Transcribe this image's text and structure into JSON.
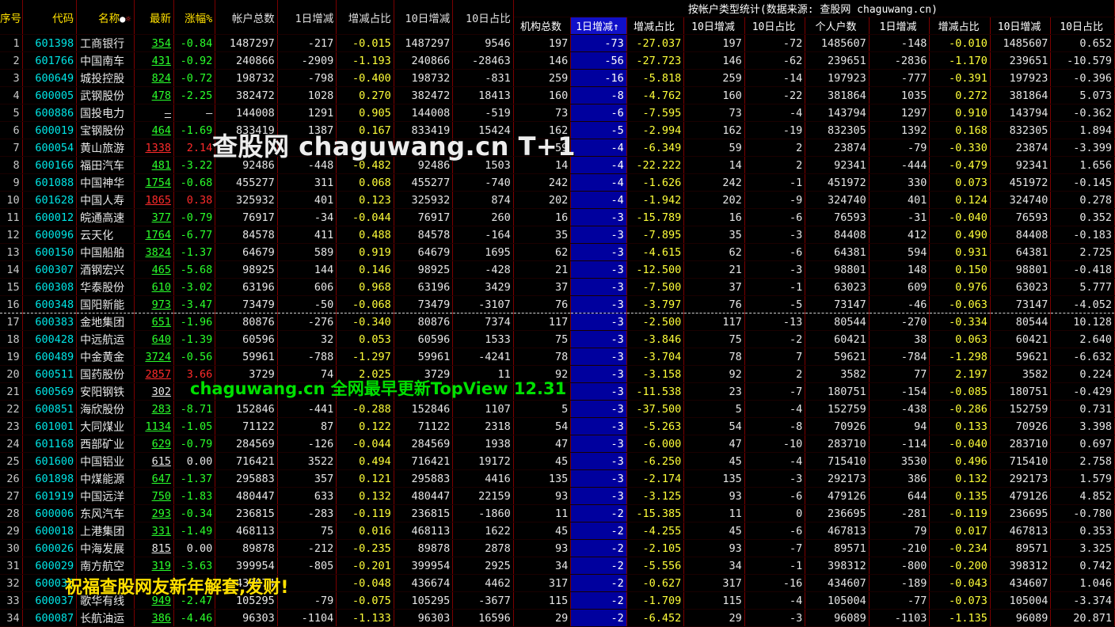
{
  "header": {
    "seq": "序号",
    "code": "代码",
    "name": "名称",
    "name_dot": "●",
    "name_sun": "☼",
    "price": "最新",
    "pct": "涨幅%",
    "total": "帐户总数",
    "d1": "1日增减",
    "ratio": "增减占比",
    "d10": "10日增减",
    "d10r": "10日占比",
    "group_title": "按帐户类型统计(数据来源: 查股网 chaguwang.cn)",
    "inst_total": "机构总数",
    "inst_d1": "1日增减↑",
    "inst_ratio": "增减占比",
    "inst_d10": "10日增减",
    "inst_d10r": "10日占比",
    "ind_total": "个人户数",
    "ind_d1": "1日增减",
    "ind_ratio": "增减占比",
    "ind_d10": "10日增减",
    "ind_d10r": "10日占比"
  },
  "watermarks": {
    "main": "查股网 chaguwang.cn T+1",
    "mid": "chaguwang.cn 全网最早更新TopView 12.31",
    "bottom": "祝福查股网友新年解套,发财!"
  },
  "colors": {
    "up": "#ff2b2b",
    "down": "#2bff2b",
    "sort_column_bg": "#00009e",
    "highlight": "#ffff3a"
  },
  "rows": [
    {
      "seq": "1",
      "code": "601398",
      "name": "工商银行",
      "price": "354",
      "pct": "-0.84",
      "total": "1487297",
      "d1": "-217",
      "ratio": "-0.015",
      "d10": "1487297",
      "d10r": "9546",
      "it": "197",
      "id1": "-73",
      "ir": "-27.037",
      "id10": "197",
      "id10r": "-72",
      "pt": "1485607",
      "pd1": "-148",
      "pr": "-0.010",
      "pd10": "1485607",
      "pd10r": "0.652"
    },
    {
      "seq": "2",
      "code": "601766",
      "name": "中国南车",
      "price": "431",
      "pct": "-0.92",
      "total": "240866",
      "d1": "-2909",
      "ratio": "-1.193",
      "d10": "240866",
      "d10r": "-28463",
      "it": "146",
      "id1": "-56",
      "ir": "-27.723",
      "id10": "146",
      "id10r": "-62",
      "pt": "239651",
      "pd1": "-2836",
      "pr": "-1.170",
      "pd10": "239651",
      "pd10r": "-10.579"
    },
    {
      "seq": "3",
      "code": "600649",
      "name": "城投控股",
      "price": "824",
      "pct": "-0.72",
      "total": "198732",
      "d1": "-798",
      "ratio": "-0.400",
      "d10": "198732",
      "d10r": "-831",
      "it": "259",
      "id1": "-16",
      "ir": "-5.818",
      "id10": "259",
      "id10r": "-14",
      "pt": "197923",
      "pd1": "-777",
      "pr": "-0.391",
      "pd10": "197923",
      "pd10r": "-0.396"
    },
    {
      "seq": "4",
      "code": "600005",
      "name": "武钢股份",
      "price": "478",
      "pct": "-2.25",
      "total": "382472",
      "d1": "1028",
      "ratio": "0.270",
      "d10": "382472",
      "d10r": "18413",
      "it": "160",
      "id1": "-8",
      "ir": "-4.762",
      "id10": "160",
      "id10r": "-22",
      "pt": "381864",
      "pd1": "1035",
      "pr": "0.272",
      "pd10": "381864",
      "pd10r": "5.073"
    },
    {
      "seq": "5",
      "code": "600886",
      "name": "国投电力",
      "price": "—",
      "pct": "—",
      "total": "144008",
      "d1": "1291",
      "ratio": "0.905",
      "d10": "144008",
      "d10r": "-519",
      "it": "73",
      "id1": "-6",
      "ir": "-7.595",
      "id10": "73",
      "id10r": "-4",
      "pt": "143794",
      "pd1": "1297",
      "pr": "0.910",
      "pd10": "143794",
      "pd10r": "-0.362"
    },
    {
      "seq": "6",
      "code": "600019",
      "name": "宝钢股份",
      "price": "464",
      "pct": "-1.69",
      "total": "833419",
      "d1": "1387",
      "ratio": "0.167",
      "d10": "833419",
      "d10r": "15424",
      "it": "162",
      "id1": "-5",
      "ir": "-2.994",
      "id10": "162",
      "id10r": "-19",
      "pt": "832305",
      "pd1": "1392",
      "pr": "0.168",
      "pd10": "832305",
      "pd10r": "1.894"
    },
    {
      "seq": "7",
      "code": "600054",
      "name": "黄山旅游",
      "price": "1338",
      "pct": "2.14",
      "total": "",
      "d1": "",
      "ratio": "",
      "d10": "",
      "d10r": "",
      "it": "59",
      "id1": "-4",
      "ir": "-6.349",
      "id10": "59",
      "id10r": "2",
      "pt": "23874",
      "pd1": "-79",
      "pr": "-0.330",
      "pd10": "23874",
      "pd10r": "-3.399"
    },
    {
      "seq": "8",
      "code": "600166",
      "name": "福田汽车",
      "price": "481",
      "pct": "-3.22",
      "total": "92486",
      "d1": "-448",
      "ratio": "-0.482",
      "d10": "92486",
      "d10r": "1503",
      "it": "14",
      "id1": "-4",
      "ir": "-22.222",
      "id10": "14",
      "id10r": "2",
      "pt": "92341",
      "pd1": "-444",
      "pr": "-0.479",
      "pd10": "92341",
      "pd10r": "1.656"
    },
    {
      "seq": "9",
      "code": "601088",
      "name": "中国神华",
      "price": "1754",
      "pct": "-0.68",
      "total": "455277",
      "d1": "311",
      "ratio": "0.068",
      "d10": "455277",
      "d10r": "-740",
      "it": "242",
      "id1": "-4",
      "ir": "-1.626",
      "id10": "242",
      "id10r": "-1",
      "pt": "451972",
      "pd1": "330",
      "pr": "0.073",
      "pd10": "451972",
      "pd10r": "-0.145"
    },
    {
      "seq": "10",
      "code": "601628",
      "name": "中国人寿",
      "price": "1865",
      "pct": "0.38",
      "total": "325932",
      "d1": "401",
      "ratio": "0.123",
      "d10": "325932",
      "d10r": "874",
      "it": "202",
      "id1": "-4",
      "ir": "-1.942",
      "id10": "202",
      "id10r": "-9",
      "pt": "324740",
      "pd1": "401",
      "pr": "0.124",
      "pd10": "324740",
      "pd10r": "0.278"
    },
    {
      "seq": "11",
      "code": "600012",
      "name": "皖通高速",
      "price": "377",
      "pct": "-0.79",
      "total": "76917",
      "d1": "-34",
      "ratio": "-0.044",
      "d10": "76917",
      "d10r": "260",
      "it": "16",
      "id1": "-3",
      "ir": "-15.789",
      "id10": "16",
      "id10r": "-6",
      "pt": "76593",
      "pd1": "-31",
      "pr": "-0.040",
      "pd10": "76593",
      "pd10r": "0.352"
    },
    {
      "seq": "12",
      "code": "600096",
      "name": "云天化",
      "price": "1764",
      "pct": "-6.77",
      "total": "84578",
      "d1": "411",
      "ratio": "0.488",
      "d10": "84578",
      "d10r": "-164",
      "it": "35",
      "id1": "-3",
      "ir": "-7.895",
      "id10": "35",
      "id10r": "-3",
      "pt": "84408",
      "pd1": "412",
      "pr": "0.490",
      "pd10": "84408",
      "pd10r": "-0.183"
    },
    {
      "seq": "13",
      "code": "600150",
      "name": "中国船舶",
      "price": "3824",
      "pct": "-1.37",
      "total": "64679",
      "d1": "589",
      "ratio": "0.919",
      "d10": "64679",
      "d10r": "1695",
      "it": "62",
      "id1": "-3",
      "ir": "-4.615",
      "id10": "62",
      "id10r": "-6",
      "pt": "64381",
      "pd1": "594",
      "pr": "0.931",
      "pd10": "64381",
      "pd10r": "2.725"
    },
    {
      "seq": "14",
      "code": "600307",
      "name": "酒钢宏兴",
      "price": "465",
      "pct": "-5.68",
      "total": "98925",
      "d1": "144",
      "ratio": "0.146",
      "d10": "98925",
      "d10r": "-428",
      "it": "21",
      "id1": "-3",
      "ir": "-12.500",
      "id10": "21",
      "id10r": "-3",
      "pt": "98801",
      "pd1": "148",
      "pr": "0.150",
      "pd10": "98801",
      "pd10r": "-0.418"
    },
    {
      "seq": "15",
      "code": "600308",
      "name": "华泰股份",
      "price": "610",
      "pct": "-3.02",
      "total": "63196",
      "d1": "606",
      "ratio": "0.968",
      "d10": "63196",
      "d10r": "3429",
      "it": "37",
      "id1": "-3",
      "ir": "-7.500",
      "id10": "37",
      "id10r": "-1",
      "pt": "63023",
      "pd1": "609",
      "pr": "0.976",
      "pd10": "63023",
      "pd10r": "5.777"
    },
    {
      "seq": "16",
      "code": "600348",
      "name": "国阳新能",
      "price": "973",
      "pct": "-3.47",
      "total": "73479",
      "d1": "-50",
      "ratio": "-0.068",
      "d10": "73479",
      "d10r": "-3107",
      "it": "76",
      "id1": "-3",
      "ir": "-3.797",
      "id10": "76",
      "id10r": "-5",
      "pt": "73147",
      "pd1": "-46",
      "pr": "-0.063",
      "pd10": "73147",
      "pd10r": "-4.052"
    },
    {
      "seq": "17",
      "code": "600383",
      "name": "金地集团",
      "price": "651",
      "pct": "-1.96",
      "total": "80876",
      "d1": "-276",
      "ratio": "-0.340",
      "d10": "80876",
      "d10r": "7374",
      "it": "117",
      "id1": "-3",
      "ir": "-2.500",
      "id10": "117",
      "id10r": "-13",
      "pt": "80544",
      "pd1": "-270",
      "pr": "-0.334",
      "pd10": "80544",
      "pd10r": "10.128"
    },
    {
      "seq": "18",
      "code": "600428",
      "name": "中远航运",
      "price": "640",
      "pct": "-1.39",
      "total": "60596",
      "d1": "32",
      "ratio": "0.053",
      "d10": "60596",
      "d10r": "1533",
      "it": "75",
      "id1": "-3",
      "ir": "-3.846",
      "id10": "75",
      "id10r": "-2",
      "pt": "60421",
      "pd1": "38",
      "pr": "0.063",
      "pd10": "60421",
      "pd10r": "2.640"
    },
    {
      "seq": "19",
      "code": "600489",
      "name": "中金黄金",
      "price": "3724",
      "pct": "-0.56",
      "total": "59961",
      "d1": "-788",
      "ratio": "-1.297",
      "d10": "59961",
      "d10r": "-4241",
      "it": "78",
      "id1": "-3",
      "ir": "-3.704",
      "id10": "78",
      "id10r": "7",
      "pt": "59621",
      "pd1": "-784",
      "pr": "-1.298",
      "pd10": "59621",
      "pd10r": "-6.632"
    },
    {
      "seq": "20",
      "code": "600511",
      "name": "国药股份",
      "price": "2857",
      "pct": "3.66",
      "total": "3729",
      "d1": "74",
      "ratio": "2.025",
      "d10": "3729",
      "d10r": "11",
      "it": "92",
      "id1": "-3",
      "ir": "-3.158",
      "id10": "92",
      "id10r": "2",
      "pt": "3582",
      "pd1": "77",
      "pr": "2.197",
      "pd10": "3582",
      "pd10r": "0.224"
    },
    {
      "seq": "21",
      "code": "600569",
      "name": "安阳钢铁",
      "price": "302",
      "pct": "",
      "total": "",
      "d1": "",
      "ratio": "",
      "d10": "",
      "d10r": "",
      "it": "",
      "id1": "-3",
      "ir": "-11.538",
      "id10": "23",
      "id10r": "-7",
      "pt": "180751",
      "pd1": "-154",
      "pr": "-0.085",
      "pd10": "180751",
      "pd10r": "-0.429"
    },
    {
      "seq": "22",
      "code": "600851",
      "name": "海欣股份",
      "price": "283",
      "pct": "-8.71",
      "total": "152846",
      "d1": "-441",
      "ratio": "-0.288",
      "d10": "152846",
      "d10r": "1107",
      "it": "5",
      "id1": "-3",
      "ir": "-37.500",
      "id10": "5",
      "id10r": "-4",
      "pt": "152759",
      "pd1": "-438",
      "pr": "-0.286",
      "pd10": "152759",
      "pd10r": "0.731"
    },
    {
      "seq": "23",
      "code": "601001",
      "name": "大同煤业",
      "price": "1134",
      "pct": "-1.05",
      "total": "71122",
      "d1": "87",
      "ratio": "0.122",
      "d10": "71122",
      "d10r": "2318",
      "it": "54",
      "id1": "-3",
      "ir": "-5.263",
      "id10": "54",
      "id10r": "-8",
      "pt": "70926",
      "pd1": "94",
      "pr": "0.133",
      "pd10": "70926",
      "pd10r": "3.398"
    },
    {
      "seq": "24",
      "code": "601168",
      "name": "西部矿业",
      "price": "629",
      "pct": "-0.79",
      "total": "284569",
      "d1": "-126",
      "ratio": "-0.044",
      "d10": "284569",
      "d10r": "1938",
      "it": "47",
      "id1": "-3",
      "ir": "-6.000",
      "id10": "47",
      "id10r": "-10",
      "pt": "283710",
      "pd1": "-114",
      "pr": "-0.040",
      "pd10": "283710",
      "pd10r": "0.697"
    },
    {
      "seq": "25",
      "code": "601600",
      "name": "中国铝业",
      "price": "615",
      "pct": "0.00",
      "total": "716421",
      "d1": "3522",
      "ratio": "0.494",
      "d10": "716421",
      "d10r": "19172",
      "it": "45",
      "id1": "-3",
      "ir": "-6.250",
      "id10": "45",
      "id10r": "-4",
      "pt": "715410",
      "pd1": "3530",
      "pr": "0.496",
      "pd10": "715410",
      "pd10r": "2.758"
    },
    {
      "seq": "26",
      "code": "601898",
      "name": "中煤能源",
      "price": "647",
      "pct": "-1.37",
      "total": "295883",
      "d1": "357",
      "ratio": "0.121",
      "d10": "295883",
      "d10r": "4416",
      "it": "135",
      "id1": "-3",
      "ir": "-2.174",
      "id10": "135",
      "id10r": "-3",
      "pt": "292173",
      "pd1": "386",
      "pr": "0.132",
      "pd10": "292173",
      "pd10r": "1.579"
    },
    {
      "seq": "27",
      "code": "601919",
      "name": "中国远洋",
      "price": "750",
      "pct": "-1.83",
      "total": "480447",
      "d1": "633",
      "ratio": "0.132",
      "d10": "480447",
      "d10r": "22159",
      "it": "93",
      "id1": "-3",
      "ir": "-3.125",
      "id10": "93",
      "id10r": "-6",
      "pt": "479126",
      "pd1": "644",
      "pr": "0.135",
      "pd10": "479126",
      "pd10r": "4.852"
    },
    {
      "seq": "28",
      "code": "600006",
      "name": "东风汽车",
      "price": "293",
      "pct": "-0.34",
      "total": "236815",
      "d1": "-283",
      "ratio": "-0.119",
      "d10": "236815",
      "d10r": "-1860",
      "it": "11",
      "id1": "-2",
      "ir": "-15.385",
      "id10": "11",
      "id10r": "0",
      "pt": "236695",
      "pd1": "-281",
      "pr": "-0.119",
      "pd10": "236695",
      "pd10r": "-0.780"
    },
    {
      "seq": "29",
      "code": "600018",
      "name": "上港集团",
      "price": "331",
      "pct": "-1.49",
      "total": "468113",
      "d1": "75",
      "ratio": "0.016",
      "d10": "468113",
      "d10r": "1622",
      "it": "45",
      "id1": "-2",
      "ir": "-4.255",
      "id10": "45",
      "id10r": "-6",
      "pt": "467813",
      "pd1": "79",
      "pr": "0.017",
      "pd10": "467813",
      "pd10r": "0.353"
    },
    {
      "seq": "30",
      "code": "600026",
      "name": "中海发展",
      "price": "815",
      "pct": "0.00",
      "total": "89878",
      "d1": "-212",
      "ratio": "-0.235",
      "d10": "89878",
      "d10r": "2878",
      "it": "93",
      "id1": "-2",
      "ir": "-2.105",
      "id10": "93",
      "id10r": "-7",
      "pt": "89571",
      "pd1": "-210",
      "pr": "-0.234",
      "pd10": "89571",
      "pd10r": "3.325"
    },
    {
      "seq": "31",
      "code": "600029",
      "name": "南方航空",
      "price": "319",
      "pct": "-3.63",
      "total": "399954",
      "d1": "-805",
      "ratio": "-0.201",
      "d10": "399954",
      "d10r": "2925",
      "it": "34",
      "id1": "-2",
      "ir": "-5.556",
      "id10": "34",
      "id10r": "-1",
      "pt": "398312",
      "pd1": "-800",
      "pr": "-0.200",
      "pd10": "398312",
      "pd10r": "0.742"
    },
    {
      "seq": "32",
      "code": "600036",
      "name": "",
      "price": "",
      "pct": "",
      "total": "436674",
      "d1": "",
      "ratio": "-0.048",
      "d10": "436674",
      "d10r": "4462",
      "it": "317",
      "id1": "-2",
      "ir": "-0.627",
      "id10": "317",
      "id10r": "-16",
      "pt": "434607",
      "pd1": "-189",
      "pr": "-0.043",
      "pd10": "434607",
      "pd10r": "1.046"
    },
    {
      "seq": "33",
      "code": "600037",
      "name": "歌华有线",
      "price": "949",
      "pct": "-2.47",
      "total": "105295",
      "d1": "-79",
      "ratio": "-0.075",
      "d10": "105295",
      "d10r": "-3677",
      "it": "115",
      "id1": "-2",
      "ir": "-1.709",
      "id10": "115",
      "id10r": "-4",
      "pt": "105004",
      "pd1": "-77",
      "pr": "-0.073",
      "pd10": "105004",
      "pd10r": "-3.374"
    },
    {
      "seq": "34",
      "code": "600087",
      "name": "长航油运",
      "price": "386",
      "pct": "-4.46",
      "total": "96303",
      "d1": "-1104",
      "ratio": "-1.133",
      "d10": "96303",
      "d10r": "16596",
      "it": "29",
      "id1": "-2",
      "ir": "-6.452",
      "id10": "29",
      "id10r": "-3",
      "pt": "96089",
      "pd1": "-1103",
      "pr": "-1.135",
      "pd10": "96089",
      "pd10r": "20.871"
    }
  ]
}
